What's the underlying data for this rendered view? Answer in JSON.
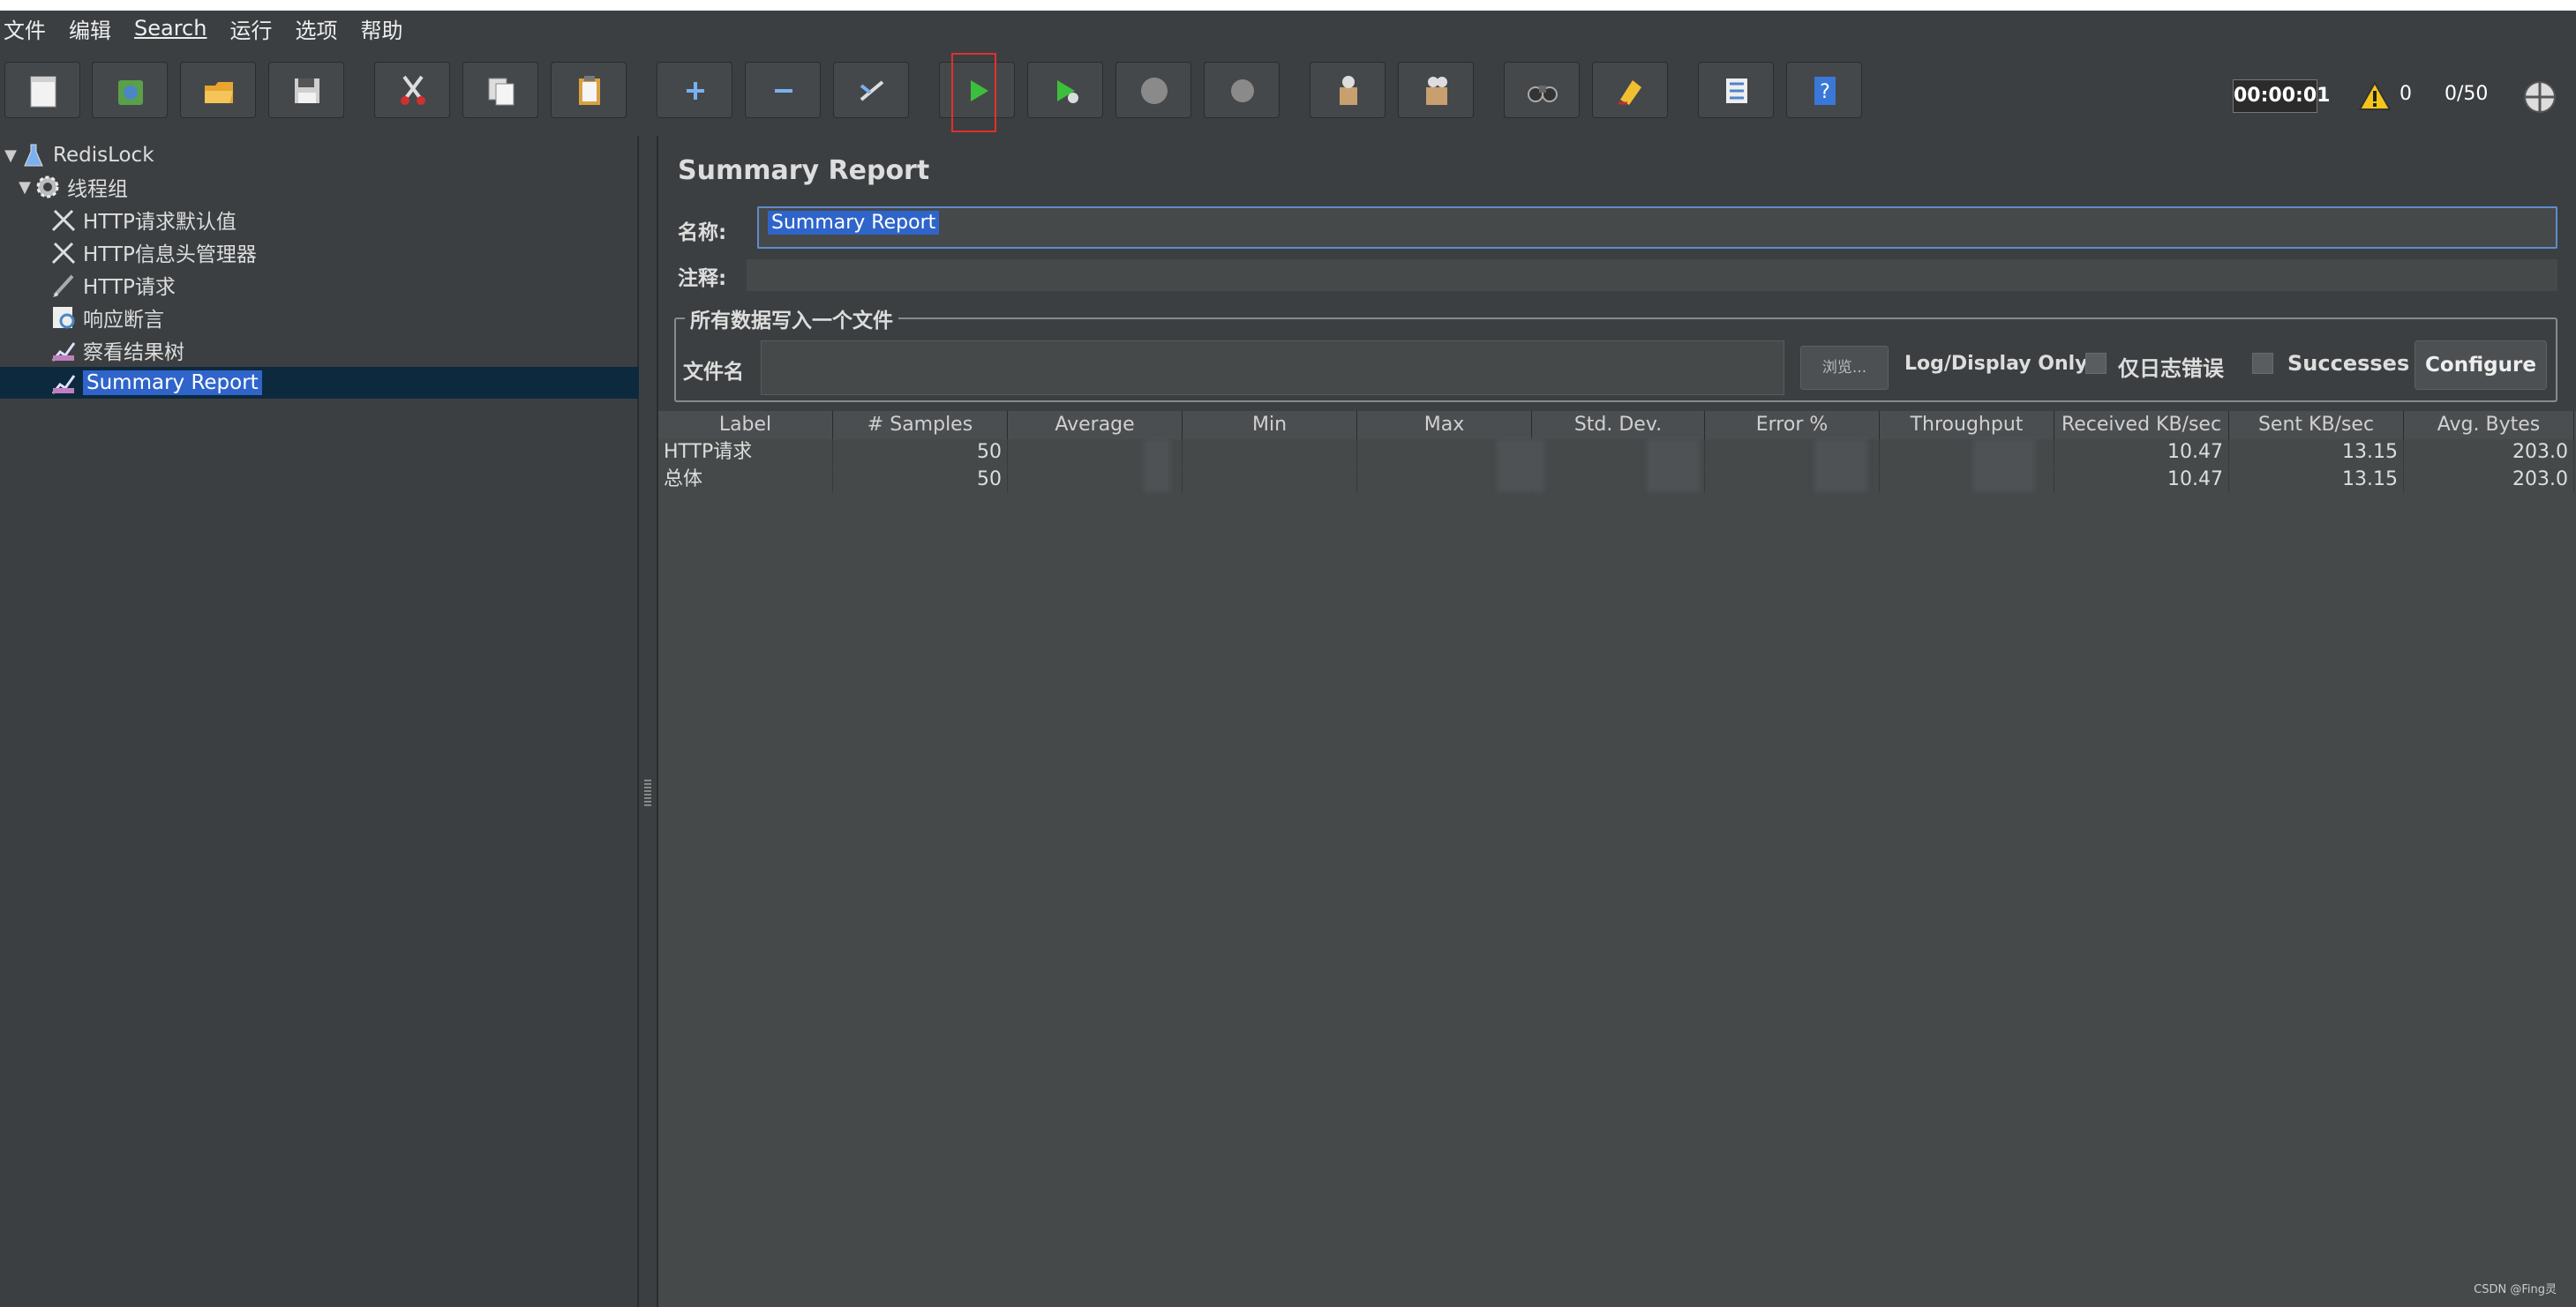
{
  "menu": [
    "文件",
    "编辑",
    "Search",
    "运行",
    "选项",
    "帮助"
  ],
  "toolbar": {
    "buttons": [
      {
        "name": "new-button",
        "icon": "new-file-icon"
      },
      {
        "name": "templates-button",
        "icon": "templates-icon"
      },
      {
        "name": "open-button",
        "icon": "folder-open-icon"
      },
      {
        "name": "save-button",
        "icon": "save-icon"
      },
      {
        "name": "cut-button",
        "icon": "scissors-icon"
      },
      {
        "name": "copy-button",
        "icon": "copy-icon"
      },
      {
        "name": "paste-button",
        "icon": "paste-icon"
      },
      {
        "name": "expand-button",
        "icon": "plus-icon"
      },
      {
        "name": "collapse-button",
        "icon": "minus-icon"
      },
      {
        "name": "toggle-button",
        "icon": "toggle-icon"
      },
      {
        "name": "start-button",
        "icon": "play-icon"
      },
      {
        "name": "start-no-pauses-button",
        "icon": "play-no-timer-icon"
      },
      {
        "name": "stop-button",
        "icon": "stop-icon"
      },
      {
        "name": "shutdown-button",
        "icon": "shutdown-icon"
      },
      {
        "name": "clear-button",
        "icon": "broom-icon"
      },
      {
        "name": "clear-all-button",
        "icon": "broom-all-icon"
      },
      {
        "name": "search-button",
        "icon": "binoculars-icon"
      },
      {
        "name": "reset-search-button",
        "icon": "reset-search-icon"
      },
      {
        "name": "function-helper-button",
        "icon": "list-icon"
      },
      {
        "name": "help-button",
        "icon": "help-icon"
      }
    ],
    "timer": "00:00:01",
    "warning_count": "0",
    "threads": "0/50"
  },
  "tree": [
    {
      "label": "RedisLock",
      "icon": "test-plan-icon",
      "expanded": true,
      "level": 0
    },
    {
      "label": "线程组",
      "icon": "thread-group-icon",
      "expanded": true,
      "level": 1
    },
    {
      "label": "HTTP请求默认值",
      "icon": "config-wrench-icon",
      "level": 2
    },
    {
      "label": "HTTP信息头管理器",
      "icon": "config-wrench-icon",
      "level": 2
    },
    {
      "label": "HTTP请求",
      "icon": "sampler-pen-icon",
      "level": 2
    },
    {
      "label": "响应断言",
      "icon": "assertion-icon",
      "level": 2
    },
    {
      "label": "察看结果树",
      "icon": "listener-graph-icon",
      "level": 2
    },
    {
      "label": "Summary Report",
      "icon": "listener-graph-icon",
      "level": 2,
      "selected": true
    }
  ],
  "panel": {
    "title": "Summary Report",
    "name_label": "名称:",
    "name_value": "Summary Report",
    "comment_label": "注释:",
    "file_group_title": "所有数据写入一个文件",
    "file_label": "文件名",
    "browse_label": "浏览...",
    "log_display_label": "Log/Display Only:",
    "errors_only_label": "仅日志错误",
    "successes_label": "Successes",
    "configure_label": "Configure"
  },
  "table": {
    "columns": [
      "Label",
      "# Samples",
      "Average",
      "Min",
      "Max",
      "Std. Dev.",
      "Error %",
      "Throughput",
      "Received KB/sec",
      "Sent KB/sec",
      "Avg. Bytes"
    ],
    "rows": [
      [
        "HTTP请求",
        "50",
        "",
        "",
        "",
        "",
        "",
        "",
        "10.47",
        "13.15",
        "203.0"
      ],
      [
        "总体",
        "50",
        "",
        "",
        "",
        "",
        "",
        "",
        "10.47",
        "13.15",
        "203.0"
      ]
    ]
  },
  "watermark": "CSDN @Fing灵"
}
